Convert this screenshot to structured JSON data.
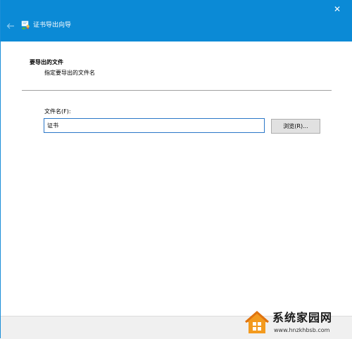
{
  "window": {
    "title": "证书导出向导",
    "close_glyph": "✕",
    "back_glyph": "←"
  },
  "header": {
    "title": "要导出的文件",
    "subtitle": "指定要导出的文件名"
  },
  "file": {
    "label": "文件名(F):",
    "value": "证书",
    "browse_label": "浏览(R)..."
  },
  "watermark": {
    "text": "系统家园网",
    "url": "www.hnzkhbsb.com"
  },
  "colors": {
    "title_bar": "#0b8ad6",
    "input_border": "#2b77c8",
    "button_face": "#e1e1e1",
    "bottom_band": "#f0f0f0"
  },
  "icons": {
    "close": "close-icon",
    "back": "back-arrow-icon",
    "wizard": "certificate-icon",
    "watermark_logo": "house-logo-icon"
  }
}
